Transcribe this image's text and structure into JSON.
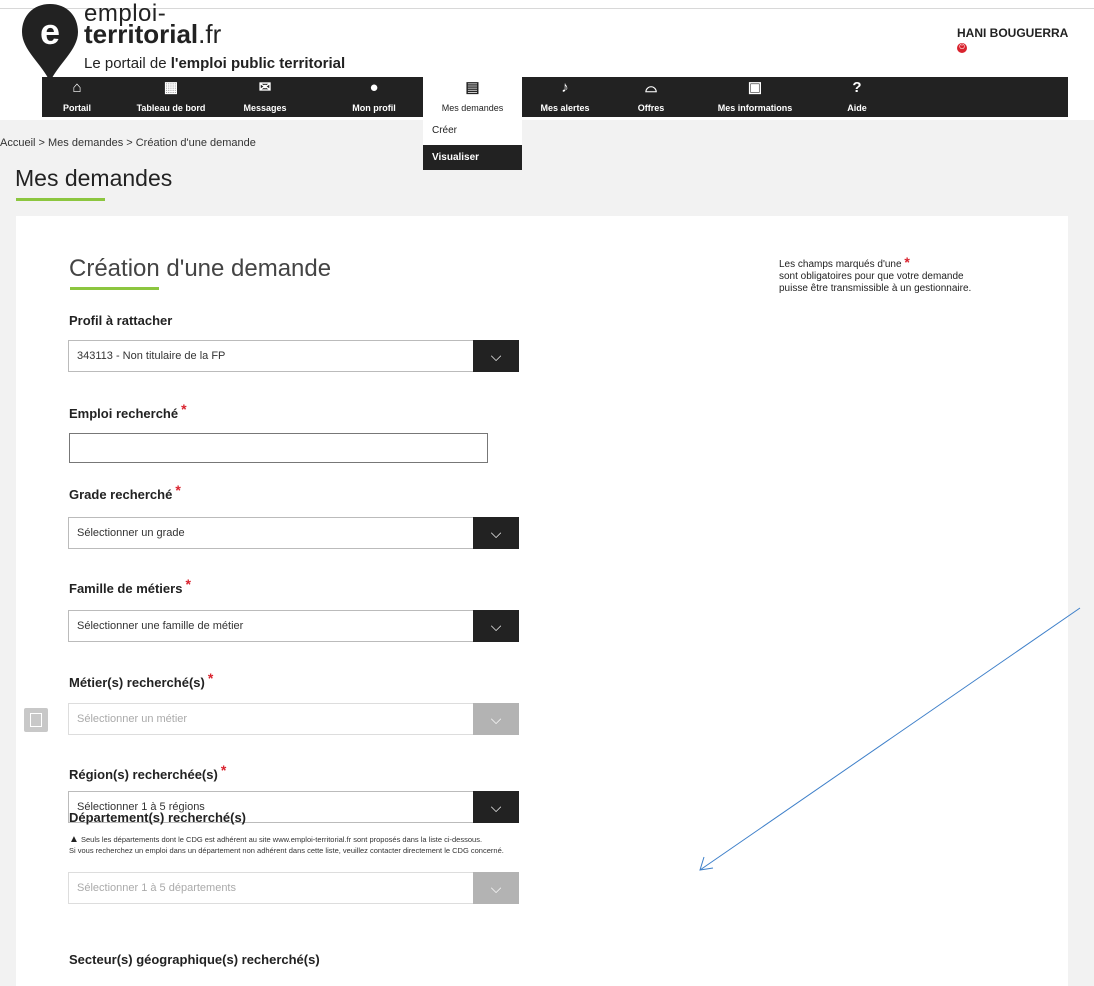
{
  "header": {
    "logo_line1": "emploi-",
    "logo_line2_bold": "territorial",
    "logo_line2_suffix": ".fr",
    "tagline_prefix": "Le portail de ",
    "tagline_bold": "l'emploi public territorial",
    "user_name": "HANI BOUGUERRA"
  },
  "nav": {
    "items": [
      {
        "label": "Portail",
        "icon": "home-icon"
      },
      {
        "label": "Tableau de bord",
        "icon": "dashboard-icon"
      },
      {
        "label": "Messages",
        "icon": "envelope-icon"
      },
      {
        "label": "Mon profil",
        "icon": "user-icon"
      },
      {
        "label": "Mes demandes",
        "icon": "document-search-icon"
      },
      {
        "label": "Mes alertes",
        "icon": "bell-icon"
      },
      {
        "label": "Offres",
        "icon": "basket-icon"
      },
      {
        "label": "Mes informations",
        "icon": "id-card-icon"
      },
      {
        "label": "Aide",
        "icon": "help-icon"
      }
    ],
    "submenu": {
      "creer": "Créer",
      "visualiser": "Visualiser"
    }
  },
  "breadcrumb": "Accueil > Mes demandes > Création d'une demande",
  "page_title": "Mes demandes",
  "form": {
    "title": "Création d'une demande",
    "note_line1": "Les champs marqués d'une",
    "note_line2": "sont obligatoires pour que votre demande",
    "note_line3": "puisse être transmissible à un gestionnaire.",
    "required_mark": "*",
    "profil_label": "Profil à rattacher",
    "profil_value": "343113 - Non titulaire de la FP",
    "emploi_label": "Emploi recherché",
    "emploi_value": "",
    "grade_label": "Grade recherché",
    "grade_value": "Sélectionner un grade",
    "famille_label": "Famille de métiers",
    "famille_value": "Sélectionner une famille de métier",
    "metier_label": "Métier(s) recherché(s)",
    "metier_value": "Sélectionner un métier",
    "region_label": "Région(s) recherchée(s)",
    "region_value": "Sélectionner 1 à 5 régions",
    "departement_label": "Département(s) recherché(s)",
    "departement_warning_1": "Seuls les départements dont le CDG est adhérent au site www.emploi-territorial.fr sont proposés dans la liste ci-dessous.",
    "departement_warning_2": "Si vous recherchez un emploi dans un département non adhérent dans cette liste, veuillez contacter directement le CDG concerné.",
    "departement_value": "Sélectionner 1 à 5 départements",
    "secteur_label": "Secteur(s) géographique(s) recherché(s)"
  },
  "colors": {
    "accent": "#8cc63f",
    "nav_bg": "#222222",
    "required": "#d9232e",
    "annotation_arrow": "#3d7fc9"
  }
}
